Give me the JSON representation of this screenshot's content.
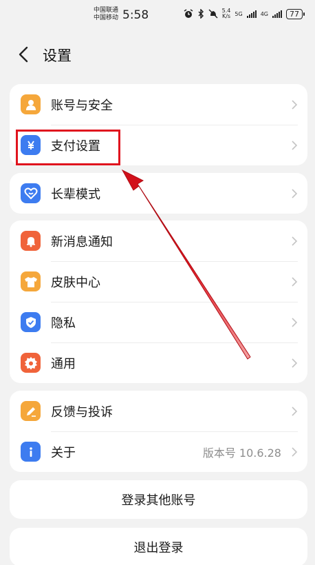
{
  "status_bar": {
    "carrier1": "中国联通",
    "carrier2": "中国移动",
    "time": "5:58",
    "net_speed_top": "5.4",
    "net_speed_bottom": "K/s",
    "signal1": "5G",
    "signal2": "4G",
    "battery": "77"
  },
  "header": {
    "title": "设置"
  },
  "groups": [
    {
      "items": [
        {
          "label": "账号与安全",
          "icon": "person-icon",
          "color": "#f5a73b"
        },
        {
          "label": "支付设置",
          "icon": "yuan-icon",
          "color": "#3d7cf0"
        }
      ]
    },
    {
      "items": [
        {
          "label": "长辈模式",
          "icon": "heart-smile-icon",
          "color": "#3d7cf0"
        }
      ]
    },
    {
      "items": [
        {
          "label": "新消息通知",
          "icon": "bell-icon",
          "color": "#f0633a"
        },
        {
          "label": "皮肤中心",
          "icon": "tshirt-icon",
          "color": "#f5a73b"
        },
        {
          "label": "隐私",
          "icon": "shield-icon",
          "color": "#3d7cf0"
        },
        {
          "label": "通用",
          "icon": "gear-icon",
          "color": "#f0633a"
        }
      ]
    },
    {
      "items": [
        {
          "label": "反馈与投诉",
          "icon": "pencil-icon",
          "color": "#f5a73b"
        },
        {
          "label": "关于",
          "icon": "info-icon",
          "color": "#3d7cf0",
          "value": "版本号 10.6.28"
        }
      ]
    }
  ],
  "buttons": {
    "switch_account": "登录其他账号",
    "logout": "退出登录"
  },
  "annotation": {
    "highlight_color": "#e0141e"
  }
}
